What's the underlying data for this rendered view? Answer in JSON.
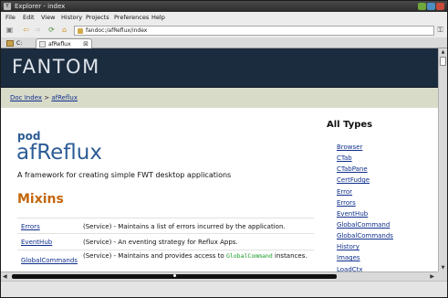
{
  "window": {
    "title": "Explorer - index"
  },
  "menu": [
    "File",
    "Edit",
    "View",
    "History",
    "Projects",
    "Preferences",
    "Help"
  ],
  "toolbar": {
    "url": "fandoc:/afReflux/index"
  },
  "tabs": [
    {
      "label": "C:"
    },
    {
      "label": "afReflux"
    }
  ],
  "banner": {
    "logo": "FANTOM"
  },
  "breadcrumb": {
    "root": "Doc Index",
    "sep": ">",
    "current": "afReflux"
  },
  "pod": {
    "label": "pod",
    "name": "afReflux",
    "description": "A framework for creating simple FWT desktop applications"
  },
  "mixins": {
    "heading": "Mixins",
    "rows": [
      {
        "name": "Errors",
        "desc": "(Service) - Maintains a list of errors incurred by the application."
      },
      {
        "name": "EventHub",
        "desc": "(Service) - An eventing strategy for Reflux Apps."
      },
      {
        "name": "GlobalCommands",
        "desc_pre": "(Service) - Maintains and provides access to ",
        "code": "GlobalCommand",
        "desc_post": " instances."
      }
    ]
  },
  "all_types": {
    "heading": "All Types",
    "items": [
      "Browser",
      "CTab",
      "CTabPane",
      "CertFudge",
      "Error",
      "Errors",
      "EventHub",
      "GlobalCommand",
      "GlobalCommands",
      "History",
      "Images",
      "LoadCtx"
    ]
  }
}
